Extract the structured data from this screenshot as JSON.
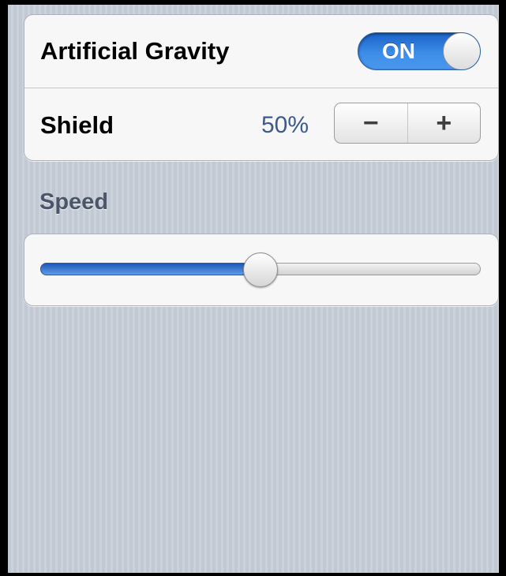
{
  "settings": {
    "artificial_gravity": {
      "label": "Artificial Gravity",
      "state": "ON"
    },
    "shield": {
      "label": "Shield",
      "value": "50%",
      "decrement": "−",
      "increment": "+"
    }
  },
  "speed": {
    "header": "Speed",
    "level_fraction": 0.5
  },
  "colors": {
    "accent": "#2f7ae0",
    "value_text": "#3c5b8c",
    "background": "#c5ccd5"
  }
}
